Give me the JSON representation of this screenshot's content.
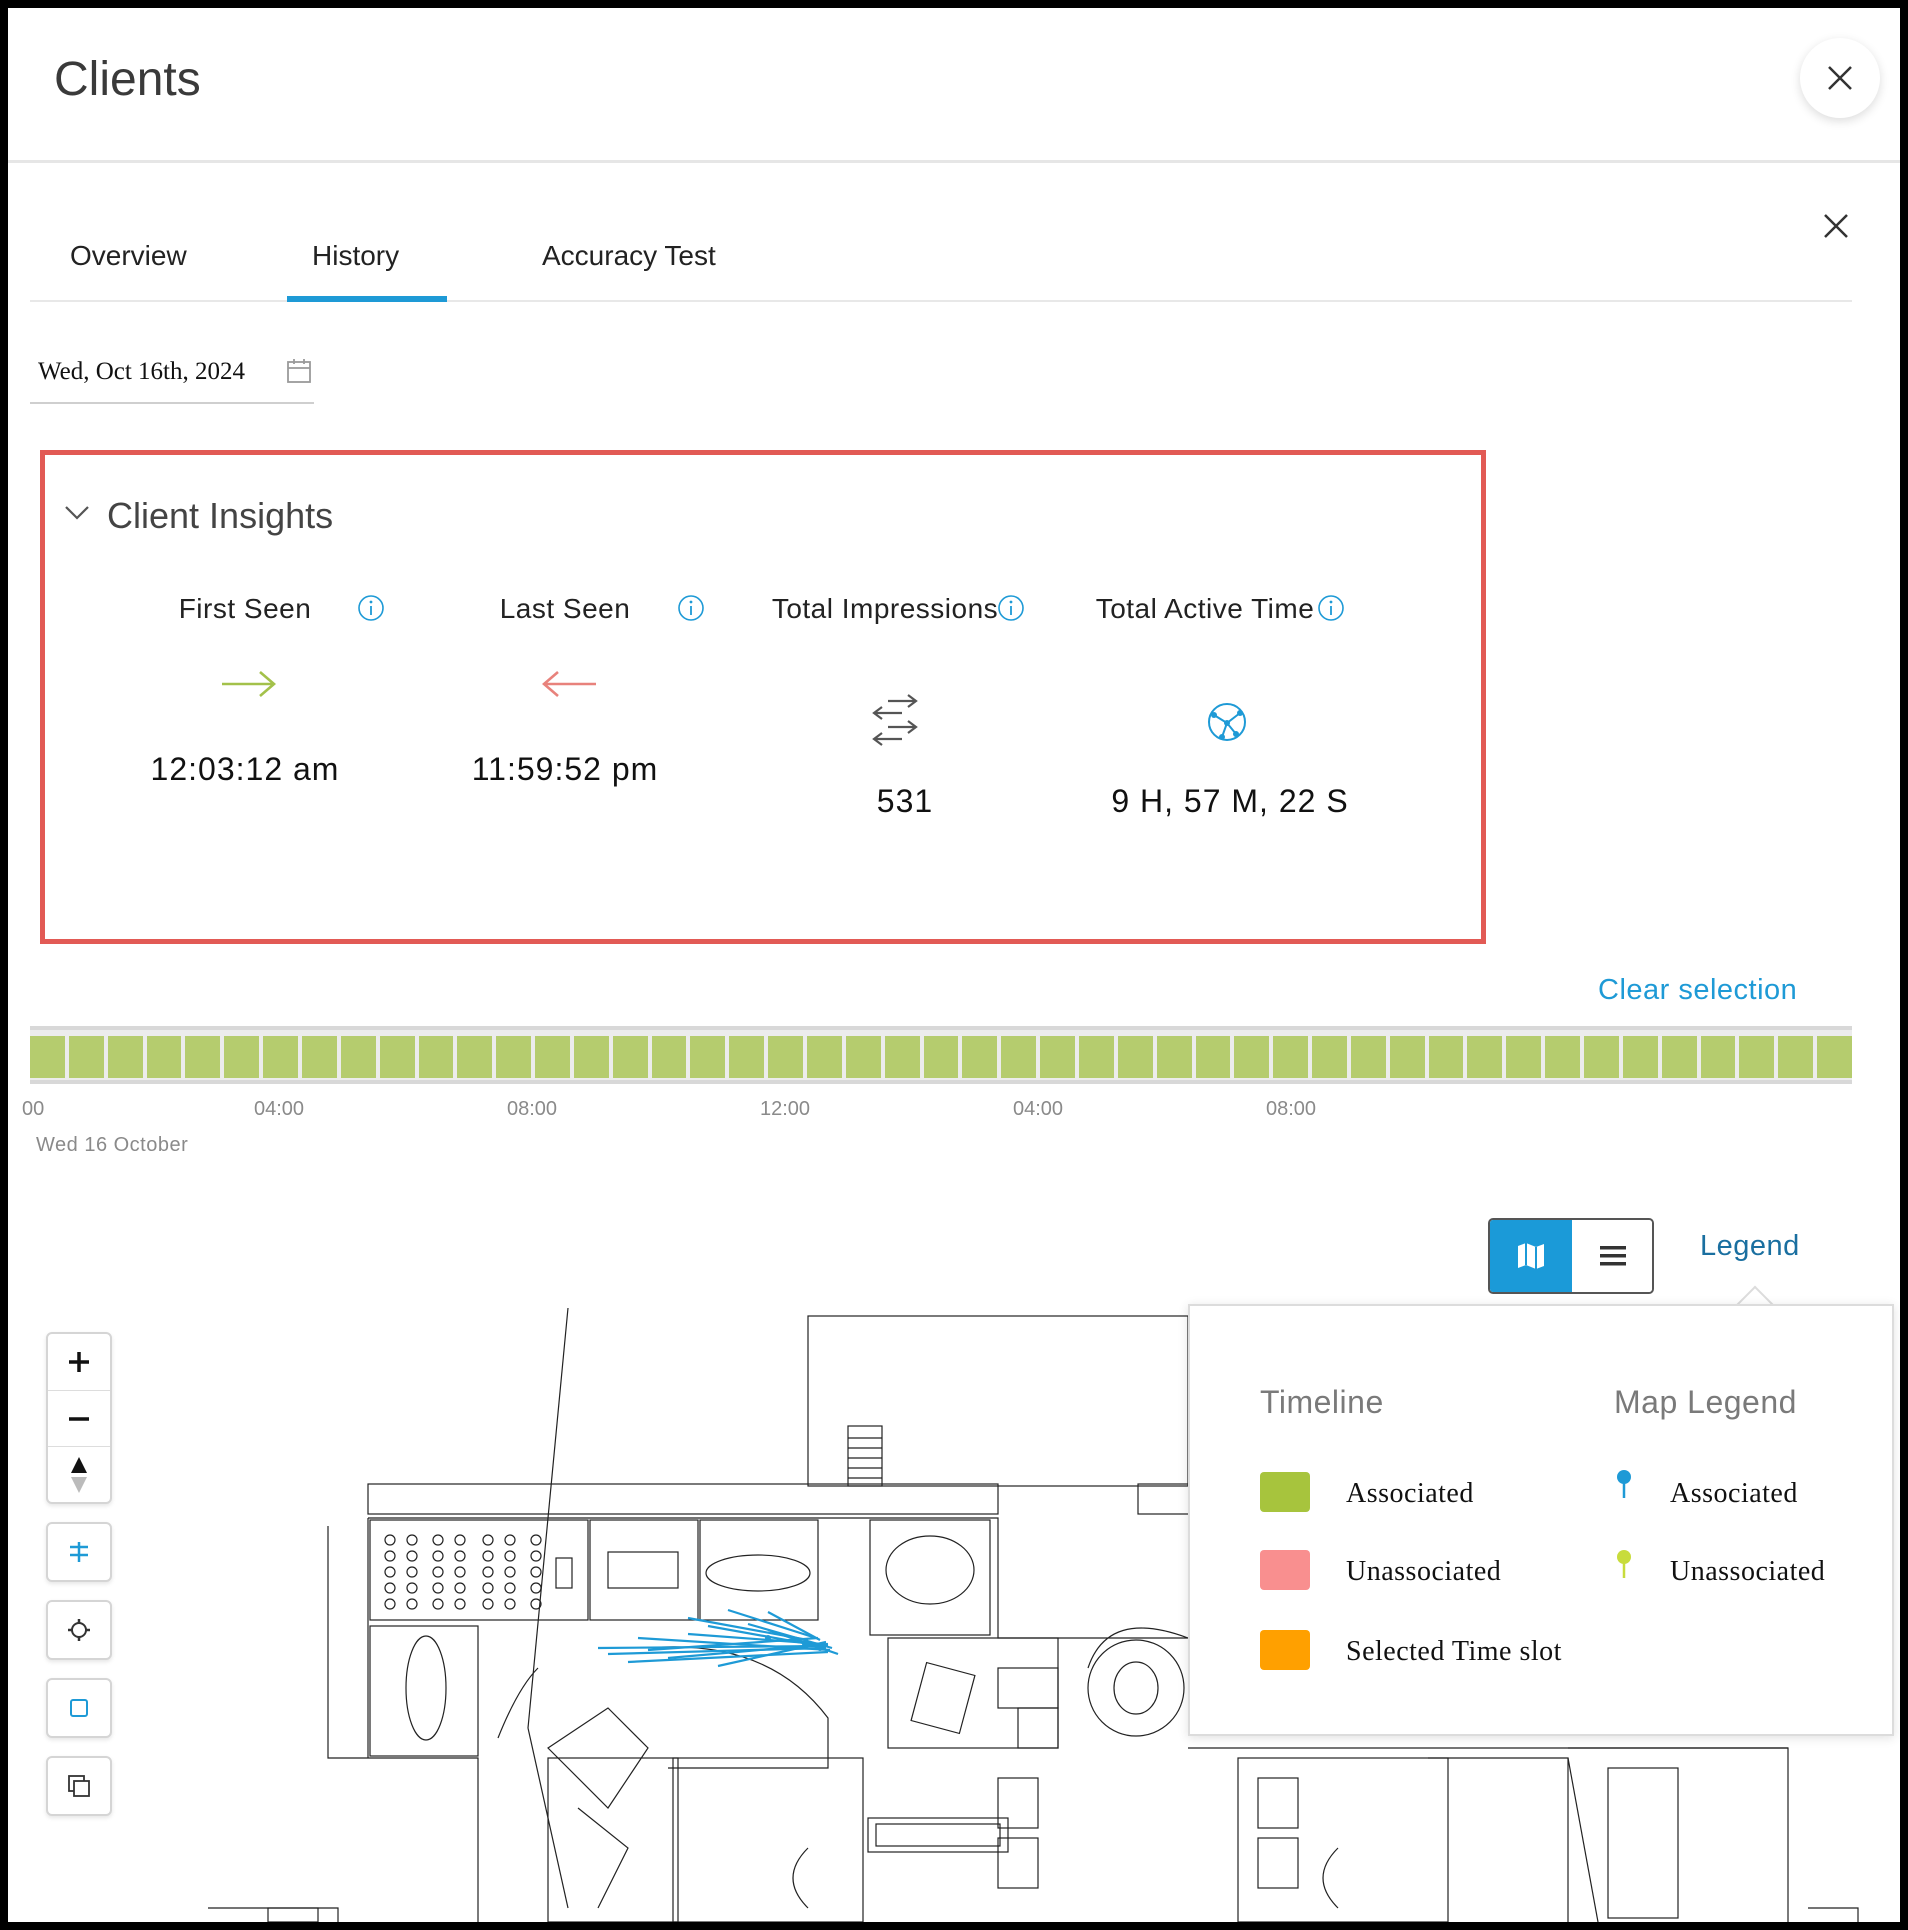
{
  "header": {
    "title": "Clients"
  },
  "tabs": [
    {
      "label": "Overview"
    },
    {
      "label": "History",
      "active": true
    },
    {
      "label": "Accuracy Test"
    }
  ],
  "date_picker": {
    "value": "Wed, Oct 16th, 2024"
  },
  "insights": {
    "title": "Client Insights",
    "metrics": [
      {
        "label": "First Seen",
        "icon": "arrow-right-icon",
        "icon_color": "#a3c14a",
        "value": "12:03:12 am"
      },
      {
        "label": "Last Seen",
        "icon": "arrow-left-icon",
        "icon_color": "#e8827c",
        "value": "11:59:52 pm"
      },
      {
        "label": "Total Impressions",
        "icon": "exchange-arrows-icon",
        "icon_color": "#555555",
        "value": "531"
      },
      {
        "label": "Total Active Time",
        "icon": "network-globe-icon",
        "icon_color": "#1e9ad6",
        "value": "9 H, 57 M, 22 S"
      }
    ]
  },
  "timeline": {
    "clear_selection_label": "Clear selection",
    "tick_labels": [
      "00",
      "04:00",
      "08:00",
      "12:00",
      "04:00",
      "08:00"
    ],
    "date_label": "Wed 16 October",
    "slot_color": "#b5cc6e",
    "slot_count": 47
  },
  "view_toggle": {
    "map_icon": "map-icon",
    "list_icon": "list-icon",
    "active": "map"
  },
  "legend": {
    "link_label": "Legend",
    "timeline_heading": "Timeline",
    "map_heading": "Map Legend",
    "timeline_items": [
      {
        "label": "Associated",
        "color": "#a7c43d"
      },
      {
        "label": "Unassociated",
        "color": "#f98f8f"
      },
      {
        "label": "Selected Time slot",
        "color": "#ffa000"
      }
    ],
    "map_items": [
      {
        "label": "Associated",
        "color": "#1e9ad6"
      },
      {
        "label": "Unassociated",
        "color": "#c8dc3c"
      }
    ]
  },
  "map_controls": [
    "zoom-in-icon",
    "zoom-out-icon",
    "compass-icon",
    "layers-filter-icon",
    "settings-icon",
    "select-square-icon",
    "copy-icon"
  ],
  "colors": {
    "accent": "#1e9ad6",
    "highlight_border": "#e25a55",
    "path_line": "#1e9ad6"
  }
}
